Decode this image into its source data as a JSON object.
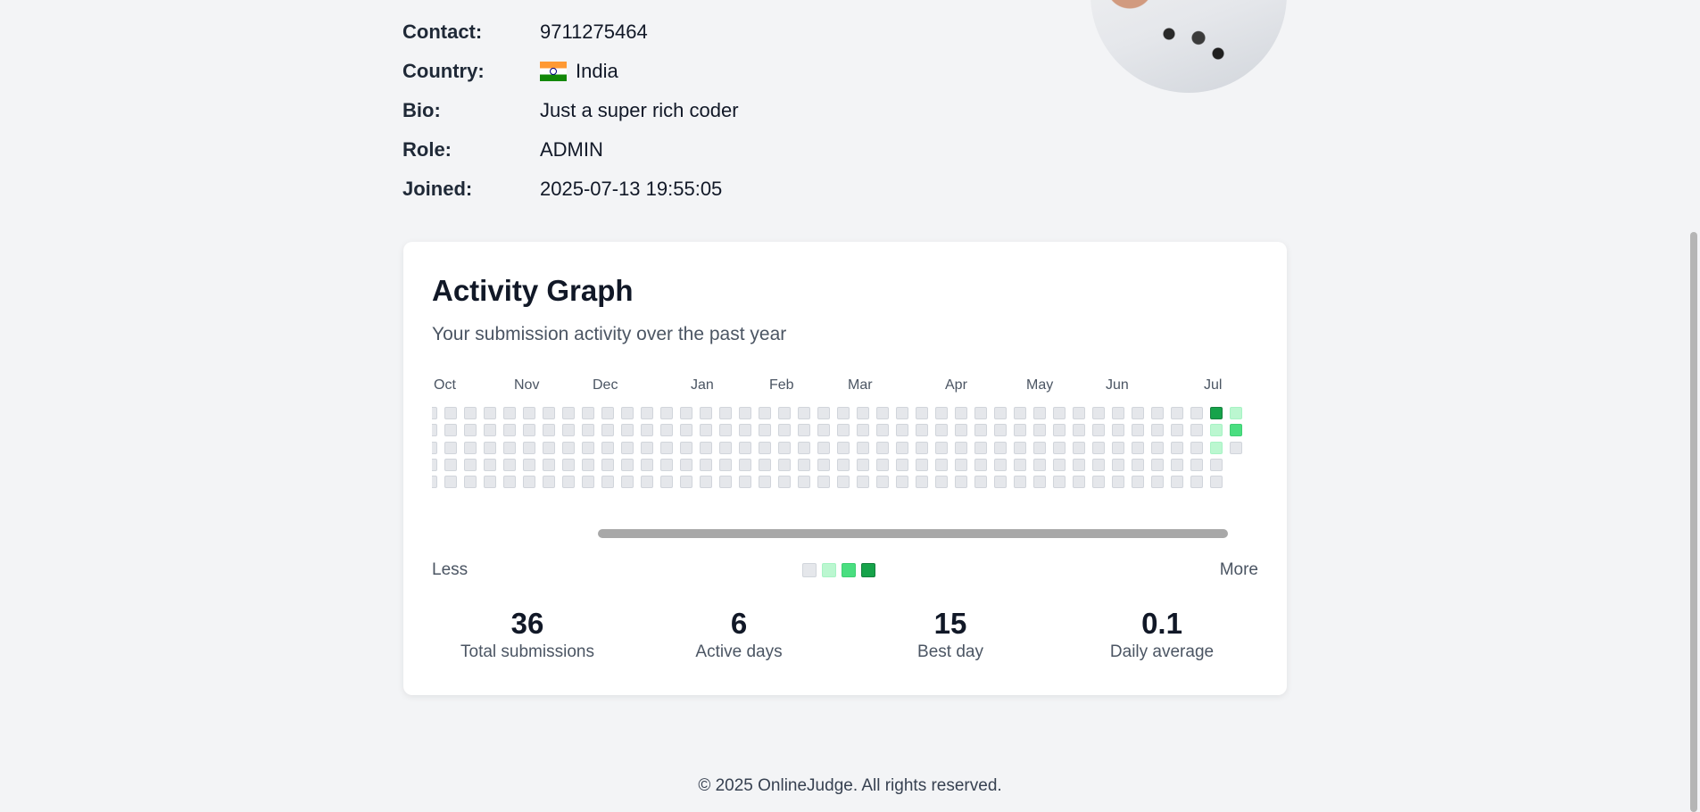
{
  "profile": {
    "rows": [
      {
        "label": "Contact:",
        "value": "9711275464"
      },
      {
        "label": "Country:",
        "value": "India",
        "flag": "india-flag-icon"
      },
      {
        "label": "Bio:",
        "value": "Just a super rich coder"
      },
      {
        "label": "Role:",
        "value": "ADMIN"
      },
      {
        "label": "Joined:",
        "value": "2025-07-13 19:55:05"
      }
    ]
  },
  "activity": {
    "title": "Activity Graph",
    "subtitle": "Your submission activity over the past year",
    "months": [
      "Oct",
      "Nov",
      "Dec",
      "Jan",
      "Feb",
      "Mar",
      "Apr",
      "May",
      "Jun",
      "Jul"
    ],
    "colors": {
      "empty": "#e5e7eb",
      "level1": "#bbf7d0",
      "level2": "#4ade80",
      "level3": "#16a34a"
    },
    "legend": {
      "less": "Less",
      "more": "More"
    },
    "stats": [
      {
        "value": "36",
        "label": "Total submissions"
      },
      {
        "value": "6",
        "label": "Active days"
      },
      {
        "value": "15",
        "label": "Best day"
      },
      {
        "value": "0.1",
        "label": "Daily average"
      }
    ]
  },
  "footer": {
    "text": "© 2025 OnlineJudge. All rights reserved."
  }
}
